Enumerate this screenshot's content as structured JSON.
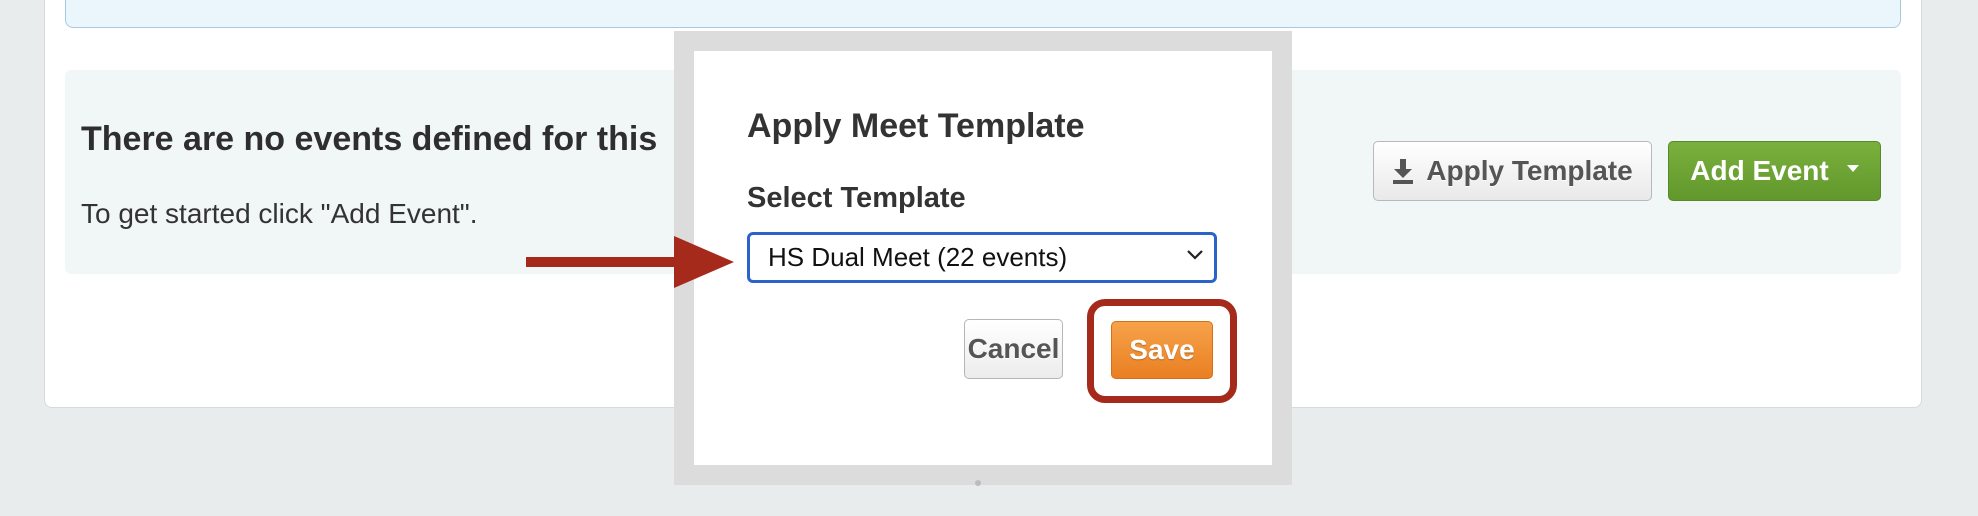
{
  "events_panel": {
    "empty_title": "There are no events defined for this",
    "empty_hint": "To get started click \"Add Event\".",
    "apply_template_label": "Apply Template",
    "add_event_label": "Add Event"
  },
  "modal": {
    "title": "Apply Meet Template",
    "select_label": "Select Template",
    "selected_template": "HS Dual Meet (22 events)",
    "cancel_label": "Cancel",
    "save_label": "Save"
  },
  "colors": {
    "add_event_green": "#6aa231",
    "save_orange": "#f0922f",
    "annotation_red": "#a52a1c",
    "select_focus_blue": "#2a63c9"
  },
  "icons": {
    "download": "download-icon",
    "caret": "caret-down-icon",
    "select_chevron": "chevron-down-icon"
  }
}
